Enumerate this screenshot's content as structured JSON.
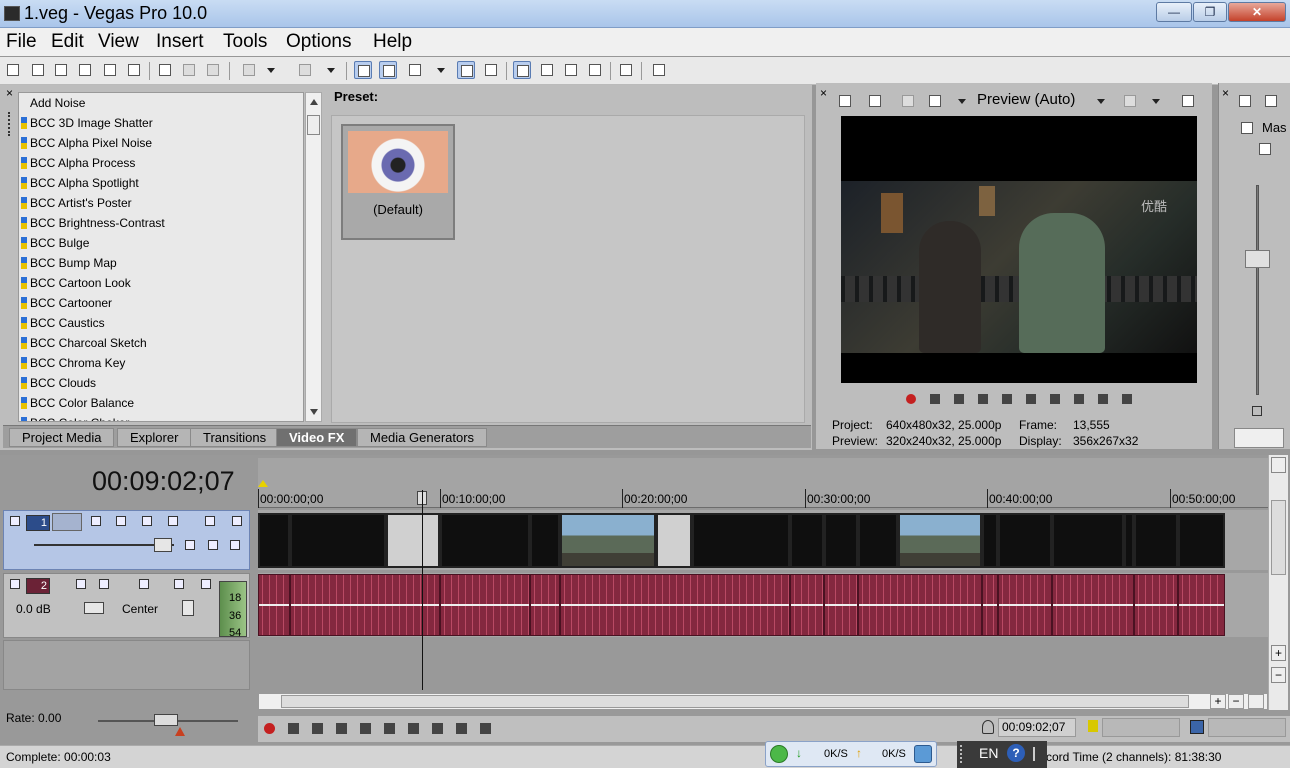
{
  "window": {
    "title": "1.veg - Vegas Pro 10.0",
    "min_glyph": "—",
    "max_glyph": "❐",
    "close_glyph": "✕"
  },
  "menu": [
    "File",
    "Edit",
    "View",
    "Insert",
    "Tools",
    "Options",
    "Help"
  ],
  "fx_list": {
    "items": [
      "Add Noise",
      "BCC 3D Image Shatter",
      "BCC Alpha Pixel Noise",
      "BCC Alpha Process",
      "BCC Alpha Spotlight",
      "BCC Artist's Poster",
      "BCC Brightness-Contrast",
      "BCC Bulge",
      "BCC Bump Map",
      "BCC Cartoon Look",
      "BCC Cartooner",
      "BCC Caustics",
      "BCC Charcoal Sketch",
      "BCC Chroma Key",
      "BCC Clouds",
      "BCC Color Balance",
      "BCC Color Choker"
    ]
  },
  "preset": {
    "label": "Preset:",
    "default_name": "(Default)"
  },
  "bottom_tabs": [
    "Project Media",
    "Explorer",
    "Transitions",
    "Video FX",
    "Media Generators"
  ],
  "preview": {
    "mode_label": "Preview (Auto)",
    "project_label": "Project:",
    "project_value": "640x480x32, 25.000p",
    "frame_label": "Frame:",
    "frame_value": "13,555",
    "preview_label": "Preview:",
    "preview_value": "320x240x32, 25.000p",
    "display_label": "Display:",
    "display_value": "356x267x32",
    "watermark": "优酷"
  },
  "master": {
    "label": "Mas"
  },
  "timeline": {
    "timecode": "00:09:02;07",
    "ruler": [
      "00:00:00;00",
      "00:10:00;00",
      "00:20:00;00",
      "00:30:00;00",
      "00:40:00;00",
      "00:50:00;00"
    ],
    "track1": {
      "number": "1"
    },
    "track2": {
      "number": "2",
      "volume": "0.0 dB",
      "pan": "Center",
      "meter": [
        "18",
        "36",
        "54"
      ]
    },
    "rate_label": "Rate: 0.00",
    "cursor_time": "00:09:02;07",
    "status_complete": "Complete: 00:00:03",
    "record_time": "cord Time (2 channels): 81:38:30"
  },
  "tray": {
    "down_speed": "0K/S",
    "up_speed": "0K/S",
    "lang": "EN"
  },
  "colors": {
    "audio_clip": "#84283f",
    "video_header": "#b5c6e6",
    "record_red": "#c42020"
  }
}
